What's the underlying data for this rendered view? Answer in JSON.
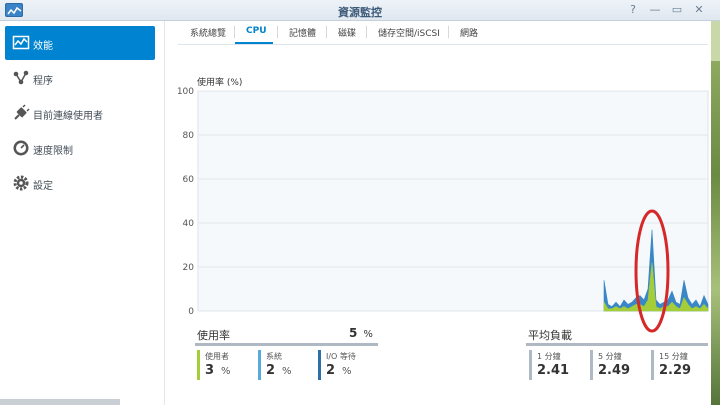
{
  "window": {
    "title": "資源監控",
    "help": "?",
    "minimize": "—",
    "maximize": "▭",
    "close": "✕"
  },
  "sidebar": {
    "items": [
      {
        "label": "效能",
        "icon": "performance-icon",
        "active": true
      },
      {
        "label": "程序",
        "icon": "process-icon",
        "active": false
      },
      {
        "label": "目前連線使用者",
        "icon": "plug-icon",
        "active": false
      },
      {
        "label": "速度限制",
        "icon": "speed-limit-icon",
        "active": false
      },
      {
        "label": "設定",
        "icon": "gear-icon",
        "active": false
      }
    ]
  },
  "tabs": [
    {
      "label": "系統總覽",
      "active": false
    },
    {
      "label": "CPU",
      "active": true
    },
    {
      "label": "記憶體",
      "active": false
    },
    {
      "label": "磁碟",
      "active": false
    },
    {
      "label": "儲存空間/iSCSI",
      "active": false
    },
    {
      "label": "網路",
      "active": false
    }
  ],
  "chart_data": {
    "type": "area",
    "title": "使用率 (%)",
    "y_ticks": [
      "100",
      "80",
      "60",
      "40",
      "20",
      "0"
    ],
    "ylim": [
      0,
      100
    ],
    "grid": true,
    "series": [
      {
        "color": "#3a87c8",
        "x": [
          0,
          2,
          4,
          6,
          8,
          10,
          12,
          14,
          16,
          18,
          20,
          22,
          24,
          26,
          28,
          30,
          32,
          34,
          36,
          38,
          40,
          42,
          44,
          46,
          48,
          50,
          52
        ],
        "values": [
          14,
          3,
          2,
          4,
          2,
          5,
          3,
          4,
          6,
          7,
          5,
          10,
          37,
          5,
          3,
          4,
          5,
          9,
          4,
          3,
          14,
          6,
          3,
          5,
          2,
          7,
          3
        ]
      },
      {
        "color": "#a5cd39",
        "x": [
          0,
          2,
          4,
          6,
          8,
          10,
          12,
          14,
          16,
          18,
          20,
          22,
          24,
          26,
          28,
          30,
          32,
          34,
          36,
          38,
          40,
          42,
          44,
          46,
          48,
          50,
          52
        ],
        "values": [
          4,
          1,
          1,
          2,
          1,
          2,
          1,
          2,
          3,
          3,
          2,
          5,
          22,
          2,
          1,
          2,
          2,
          4,
          2,
          1,
          6,
          3,
          1,
          2,
          1,
          3,
          1
        ]
      }
    ],
    "annotation": "red-ellipse-around-spike"
  },
  "usage": {
    "title": "使用率",
    "total_value": "5",
    "total_unit": "%",
    "metrics": [
      {
        "name": "使用者",
        "value": "3",
        "unit": "%",
        "color": "#a5cd39"
      },
      {
        "name": "系統",
        "value": "2",
        "unit": "%",
        "color": "#5aa9dd"
      },
      {
        "name": "I/O 等待",
        "value": "2",
        "unit": "%",
        "color": "#2f6fa8"
      }
    ]
  },
  "load": {
    "title": "平均負載",
    "metrics": [
      {
        "name": "1 分鐘",
        "value": "2.41",
        "color": "#aeb9c3"
      },
      {
        "name": "5 分鐘",
        "value": "2.49",
        "color": "#aeb9c3"
      },
      {
        "name": "15 分鐘",
        "value": "2.29",
        "color": "#aeb9c3"
      }
    ]
  }
}
